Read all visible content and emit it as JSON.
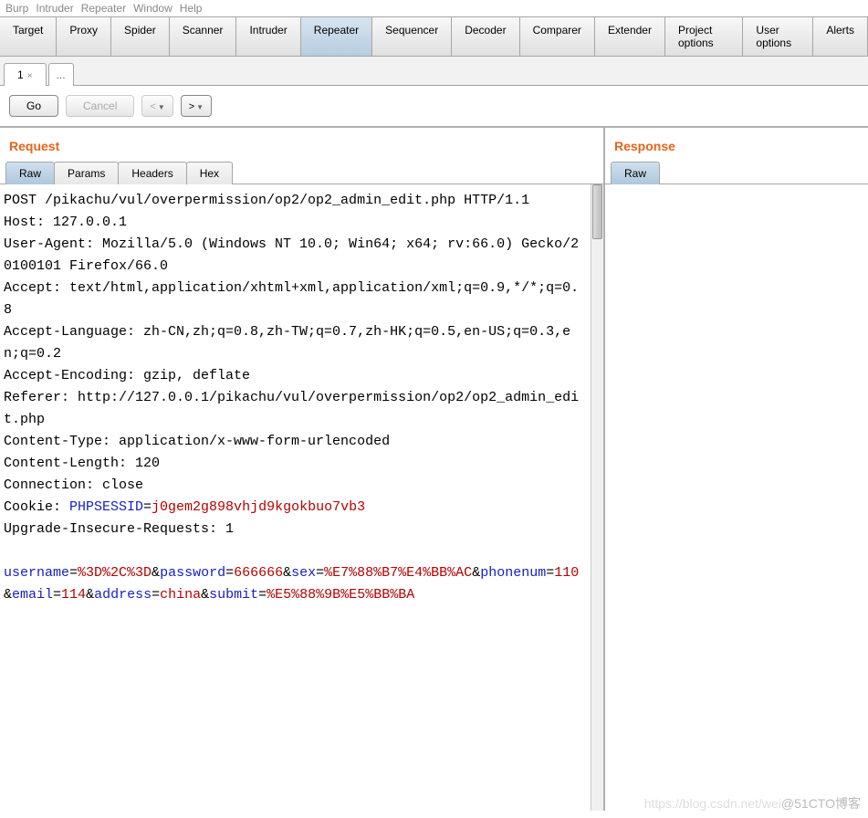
{
  "menubar": [
    "Burp",
    "Intruder",
    "Repeater",
    "Window",
    "Help"
  ],
  "mainTabs": [
    {
      "label": "Target"
    },
    {
      "label": "Proxy"
    },
    {
      "label": "Spider"
    },
    {
      "label": "Scanner"
    },
    {
      "label": "Intruder"
    },
    {
      "label": "Repeater",
      "active": true
    },
    {
      "label": "Sequencer"
    },
    {
      "label": "Decoder"
    },
    {
      "label": "Comparer"
    },
    {
      "label": "Extender"
    },
    {
      "label": "Project options"
    },
    {
      "label": "User options"
    },
    {
      "label": "Alerts"
    }
  ],
  "subTabs": [
    {
      "label": "1",
      "active": true,
      "closable": true
    },
    {
      "label": "...",
      "dots": true
    }
  ],
  "toolbar": {
    "go": "Go",
    "cancel": "Cancel",
    "prev": "<",
    "next": ">"
  },
  "request": {
    "title": "Request",
    "viewTabs": [
      {
        "label": "Raw",
        "active": true
      },
      {
        "label": "Params"
      },
      {
        "label": "Headers"
      },
      {
        "label": "Hex"
      }
    ],
    "headersText": "POST /pikachu/vul/overpermission/op2/op2_admin_edit.php HTTP/1.1\nHost: 127.0.0.1\nUser-Agent: Mozilla/5.0 (Windows NT 10.0; Win64; x64; rv:66.0) Gecko/20100101 Firefox/66.0\nAccept: text/html,application/xhtml+xml,application/xml;q=0.9,*/*;q=0.8\nAccept-Language: zh-CN,zh;q=0.8,zh-TW;q=0.7,zh-HK;q=0.5,en-US;q=0.3,en;q=0.2\nAccept-Encoding: gzip, deflate\nReferer: http://127.0.0.1/pikachu/vul/overpermission/op2/op2_admin_edit.php\nContent-Type: application/x-www-form-urlencoded\nContent-Length: 120\nConnection: close\nCookie: ",
    "cookieKey": "PHPSESSID",
    "cookieVal": "j0gem2g898vhjd9kgokbuo7vb3",
    "afterCookie": "\nUpgrade-Insecure-Requests: 1\n\n",
    "body": [
      {
        "k": "username",
        "v": "%3D%2C%3D"
      },
      {
        "k": "password",
        "v": "666666"
      },
      {
        "k": "sex",
        "v": "%E7%88%B7%E4%BB%AC"
      },
      {
        "k": "phonenum",
        "v": "110"
      },
      {
        "k": "email",
        "v": "114"
      },
      {
        "k": "address",
        "v": "china"
      },
      {
        "k": "submit",
        "v": "%E5%88%9B%E5%BB%BA"
      }
    ]
  },
  "response": {
    "title": "Response",
    "viewTabs": [
      {
        "label": "Raw",
        "active": true
      }
    ]
  },
  "watermark": "@51CTO博客",
  "watermarkGhost": "https://blog.csdn.net/wei"
}
